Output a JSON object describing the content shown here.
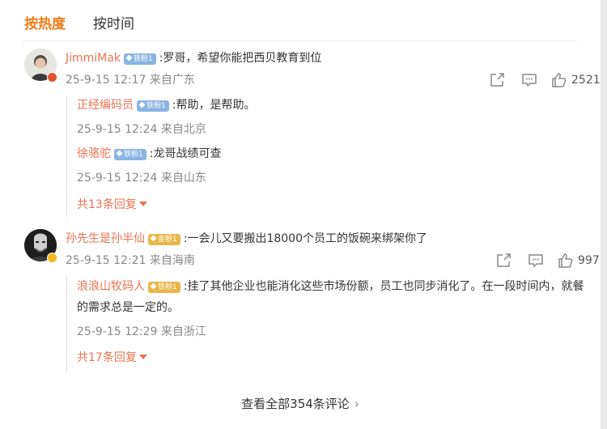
{
  "tabs": {
    "hot": "按热度",
    "time": "按时间"
  },
  "comments": [
    {
      "user": "JimmiMak",
      "badge": "铁粉1",
      "text": ":罗哥，希望你能把西贝教育到位",
      "meta": "25-9-15 12:17 来自广东",
      "likes": "2521",
      "replies": [
        {
          "user": "正经编码员",
          "badge": "铁粉1",
          "text": ":帮助，是帮助。",
          "meta": "25-9-15 12:24 来自北京"
        },
        {
          "user": "徐骆驼",
          "badge": "铁粉1",
          "text": ":龙哥战绩可查",
          "meta": "25-9-15 12:24 来自山东"
        }
      ],
      "more": "共13条回复"
    },
    {
      "user": "孙先生是孙半仙",
      "badge": "金粉1",
      "text": ":一会儿又要搬出18000个员工的饭碗来绑架你了",
      "meta": "25-9-15 12:21 来自海南",
      "likes": "997",
      "replies": [
        {
          "user": "浪浪山牧码人",
          "badge": "铁粉1",
          "text": ":挂了其他企业也能消化这些市场份额，员工也同步消化了。在一段时间内，就餐的需求总是一定的。",
          "meta": "25-9-15 12:29 来自浙江"
        }
      ],
      "more": "共17条回复"
    }
  ],
  "view_all": "查看全部354条评论",
  "colors": {
    "accent": "#f27b15",
    "username": "#eb7350",
    "meta": "#888888",
    "fan_blue": "#8ab4e4",
    "fan_gold": "#e9b64a"
  },
  "icons": {
    "share": "share-icon",
    "comment": "comment-icon",
    "like": "like-icon",
    "more": "chevron-right-icon"
  }
}
